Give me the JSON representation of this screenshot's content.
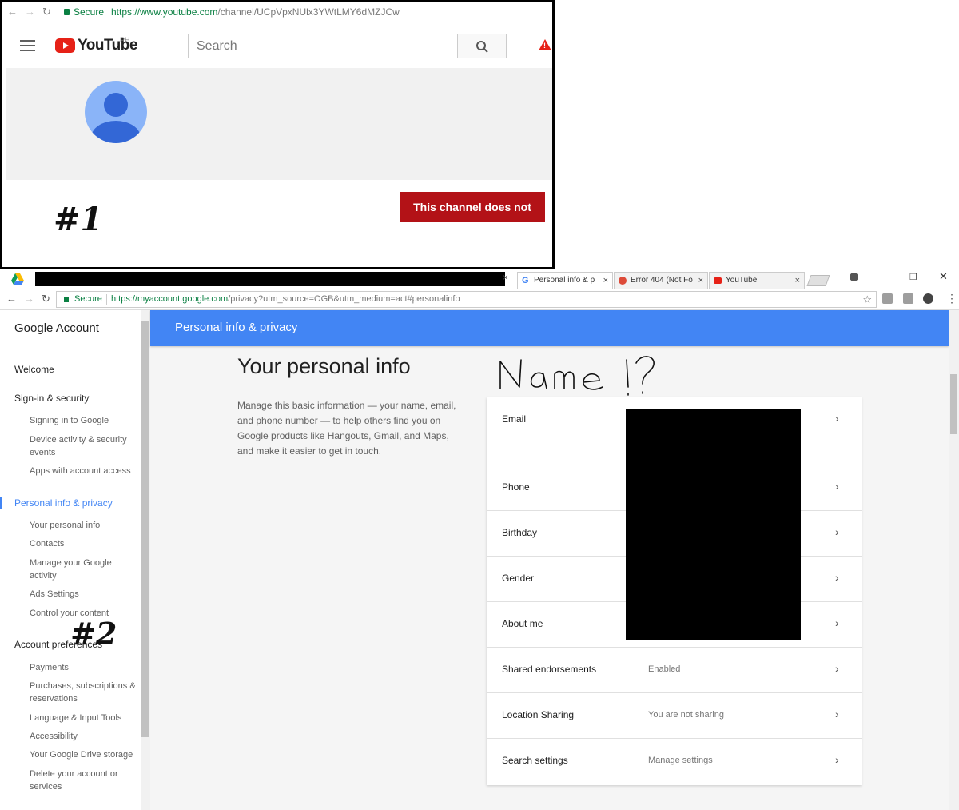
{
  "youtube": {
    "secure_label": "Secure",
    "url_host": "https://www.youtube.com",
    "url_path": "/channel/UCpVpxNUlx3YWtLMY6dMZJCw",
    "logo_text": "YouTube",
    "region": "PH",
    "search_placeholder": "Search",
    "warning_glyph": "!",
    "error_message": "This channel does not exist.",
    "annotation": "#1"
  },
  "chrome": {
    "tabs": [
      {
        "title": "Personal info & p",
        "icon": "google-icon"
      },
      {
        "title": "Error 404 (Not Fo",
        "icon": "google-plus-icon"
      },
      {
        "title": "YouTube",
        "icon": "youtube-icon"
      }
    ],
    "close_glyph": "×",
    "window_controls": {
      "minimize": "–",
      "maximize": "❐",
      "close": "✕"
    },
    "secure_label": "Secure",
    "url_host": "https://myaccount.google.com",
    "url_path": "/privacy?utm_source=OGB&utm_medium=act#personalinfo",
    "star_glyph": "☆"
  },
  "sidebar": {
    "title": "Google Account",
    "welcome": "Welcome",
    "signin_heading": "Sign-in & security",
    "signin_items": [
      "Signing in to Google",
      "Device activity & security events",
      "Apps with account access"
    ],
    "personal_heading": "Personal info & privacy",
    "personal_items": [
      "Your personal info",
      "Contacts",
      "Manage your Google activity",
      "Ads Settings",
      "Control your content"
    ],
    "account_heading": "Account preferences",
    "account_items": [
      "Payments",
      "Purchases, subscriptions & reservations",
      "Language & Input Tools",
      "Accessibility",
      "Your Google Drive storage",
      "Delete your account or services"
    ],
    "annotation": "#2"
  },
  "main": {
    "header": "Personal info & privacy",
    "title": "Your personal info",
    "description": "Manage this basic information — your name, email, and phone number — to help others find you on Google products like Hangouts, Gmail, and Maps, and make it easier to get in touch.",
    "handwritten_note": "Name !?",
    "rows": [
      {
        "label": "Email",
        "value": ""
      },
      {
        "label": "Phone",
        "value": ""
      },
      {
        "label": "Birthday",
        "value": ""
      },
      {
        "label": "Gender",
        "value": ""
      },
      {
        "label": "About me",
        "value": ""
      },
      {
        "label": "Shared endorsements",
        "value": "Enabled"
      },
      {
        "label": "Location Sharing",
        "value": "You are not sharing"
      },
      {
        "label": "Search settings",
        "value": "Manage settings"
      }
    ],
    "chevron_glyph": "›"
  }
}
